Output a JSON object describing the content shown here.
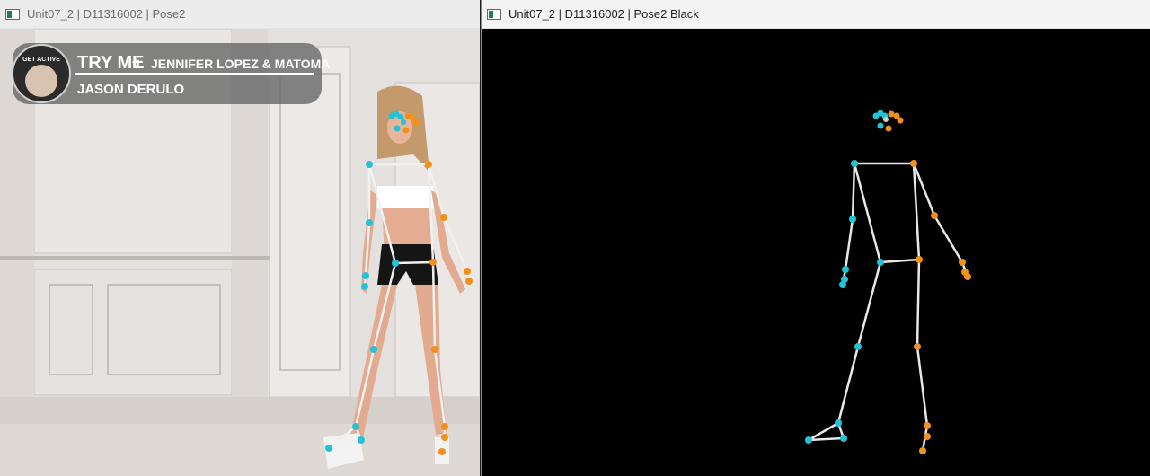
{
  "left_window": {
    "title": "Unit07_2 | D11316002 | Pose2",
    "overlay": {
      "logo_text": "GET ACTIVE",
      "song_title": "TRY ME",
      "featuring": "ft.",
      "featured_artists": "JENNIFER LOPEZ & MATOMA",
      "artist": "JASON DERULO"
    }
  },
  "right_window": {
    "title": "Unit07_2 | D11316002 | Pose2 Black"
  },
  "colors": {
    "left_joint": "#22c3d6",
    "right_joint": "#f39019",
    "bone": "#e8e8e8",
    "background_black": "#000000"
  },
  "icons": [
    "window-app-icon"
  ]
}
